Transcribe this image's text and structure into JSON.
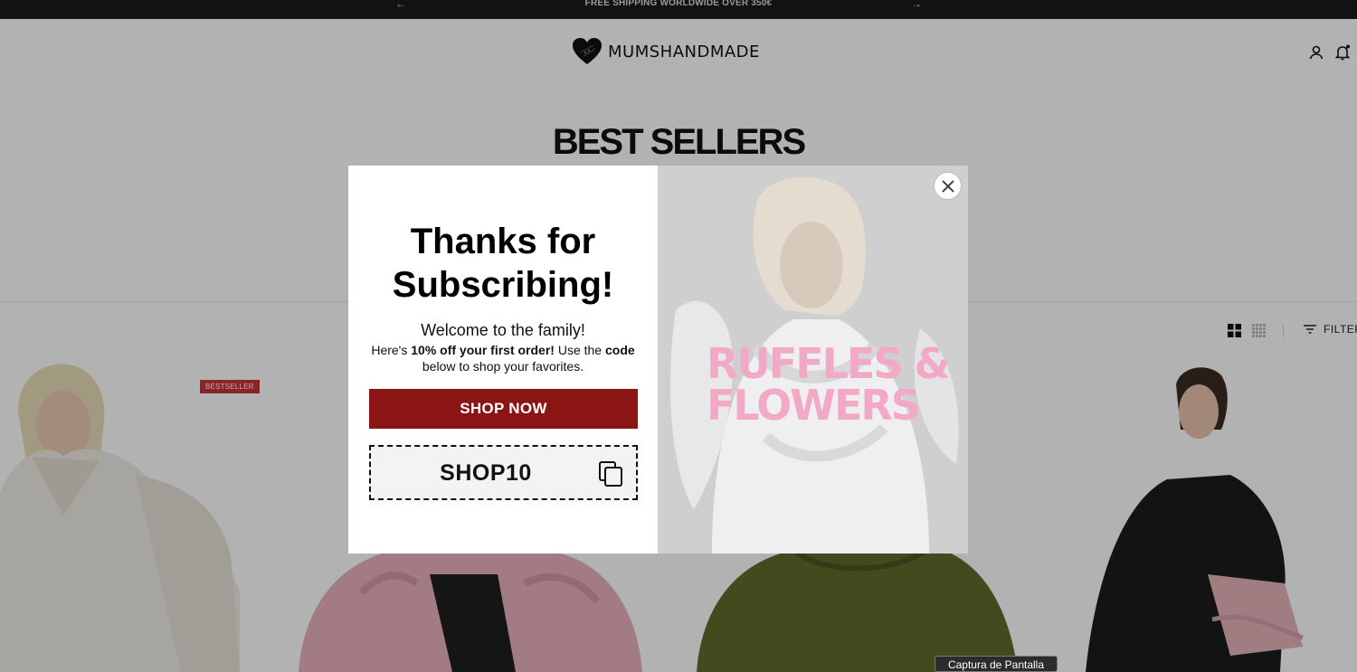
{
  "announcement": {
    "message": "FREE SHIPPING WORLDWIDE OVER 350€",
    "prev_icon": "←",
    "next_icon": "→"
  },
  "header": {
    "logo_text": "MUMSHANDMADE",
    "icons": [
      "account-icon",
      "notification-bell-icon"
    ]
  },
  "page": {
    "title": "BEST SELLERS"
  },
  "toolbar": {
    "filter_label": "FILTER",
    "view_icons": [
      "grid-large-icon",
      "grid-small-icon"
    ]
  },
  "products": [
    {
      "badge": "BESTSELLER",
      "image": "cream-turtleneck-sweater"
    },
    {
      "image": "pink-chunky-cardigan"
    },
    {
      "image": "green-knit-sweater"
    },
    {
      "image": "black-blazer-model"
    }
  ],
  "popup": {
    "title_line1": "Thanks for",
    "title_line2": "Subscribing!",
    "welcome": "Welcome to the family!",
    "offer_pre": "Here's ",
    "offer_bold": "10% off your first order!",
    "offer_mid": " Use the ",
    "offer_code_word": "code",
    "offer_post": " below to shop your favorites.",
    "shop_button": "SHOP NOW",
    "code": "SHOP10",
    "promo_line1": "RUFFLES &",
    "promo_line2": "FLOWERS",
    "colors": {
      "button": "#8b1414",
      "promo_text": "#f2a9c8"
    }
  },
  "tooltip": {
    "text": "Captura de Pantalla"
  }
}
